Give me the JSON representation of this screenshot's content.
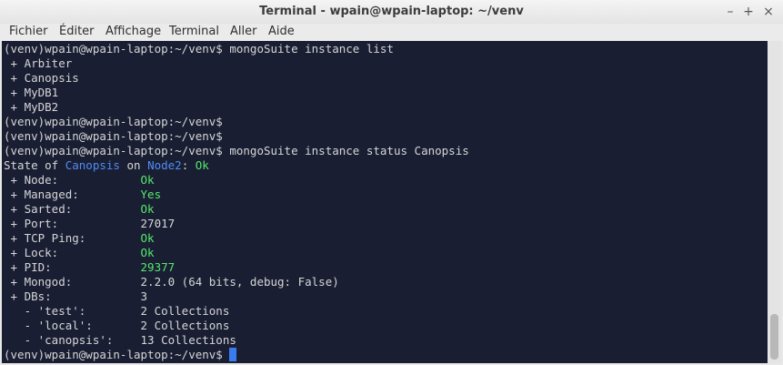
{
  "window": {
    "title": "Terminal - wpain@wpain-laptop: ~/venv",
    "controls": {
      "minimize": "–",
      "maximize": "+",
      "close": "×"
    }
  },
  "menu": [
    "Fichier",
    "Éditer",
    "Affichage",
    "Terminal",
    "Aller",
    "Aide"
  ],
  "terminal": {
    "lines": [
      [
        {
          "t": "(venv)wpain@wpain-laptop:~/venv$ mongoSuite instance list"
        }
      ],
      [
        {
          "t": " + Arbiter"
        }
      ],
      [
        {
          "t": " + Canopsis"
        }
      ],
      [
        {
          "t": " + MyDB1"
        }
      ],
      [
        {
          "t": " + MyDB2"
        }
      ],
      [
        {
          "t": "(venv)wpain@wpain-laptop:~/venv$"
        }
      ],
      [
        {
          "t": "(venv)wpain@wpain-laptop:~/venv$"
        }
      ],
      [
        {
          "t": "(venv)wpain@wpain-laptop:~/venv$ mongoSuite instance status Canopsis"
        }
      ],
      [
        {
          "t": "State of "
        },
        {
          "t": "Canopsis",
          "c": "blue"
        },
        {
          "t": " on "
        },
        {
          "t": "Node2",
          "c": "blue"
        },
        {
          "t": ": "
        },
        {
          "t": "Ok",
          "c": "green"
        }
      ],
      [
        {
          "t": " + Node:            "
        },
        {
          "t": "Ok",
          "c": "green"
        }
      ],
      [
        {
          "t": " + Managed:         "
        },
        {
          "t": "Yes",
          "c": "green"
        }
      ],
      [
        {
          "t": " + Sarted:          "
        },
        {
          "t": "Ok",
          "c": "green"
        }
      ],
      [
        {
          "t": " + Port:            27017"
        }
      ],
      [
        {
          "t": " + TCP Ping:        "
        },
        {
          "t": "Ok",
          "c": "green"
        }
      ],
      [
        {
          "t": " + Lock:            "
        },
        {
          "t": "Ok",
          "c": "green"
        }
      ],
      [
        {
          "t": " + PID:             "
        },
        {
          "t": "29377",
          "c": "green"
        }
      ],
      [
        {
          "t": " + Mongod:          2.2.0 (64 bits, debug: False)"
        }
      ],
      [
        {
          "t": " + DBs:             3"
        }
      ],
      [
        {
          "t": "   - 'test':        2 Collections"
        }
      ],
      [
        {
          "t": "   - 'local':       2 Collections"
        }
      ],
      [
        {
          "t": "   - 'canopsis':    13 Collections"
        }
      ],
      [
        {
          "t": "(venv)wpain@wpain-laptop:~/venv$ "
        }
      ]
    ]
  },
  "colors": {
    "background": "#1a1e33",
    "text": "#d6d6d6",
    "blue": "#4f8cf5",
    "green": "#55e96c",
    "cursor": "#3a7bf2"
  }
}
